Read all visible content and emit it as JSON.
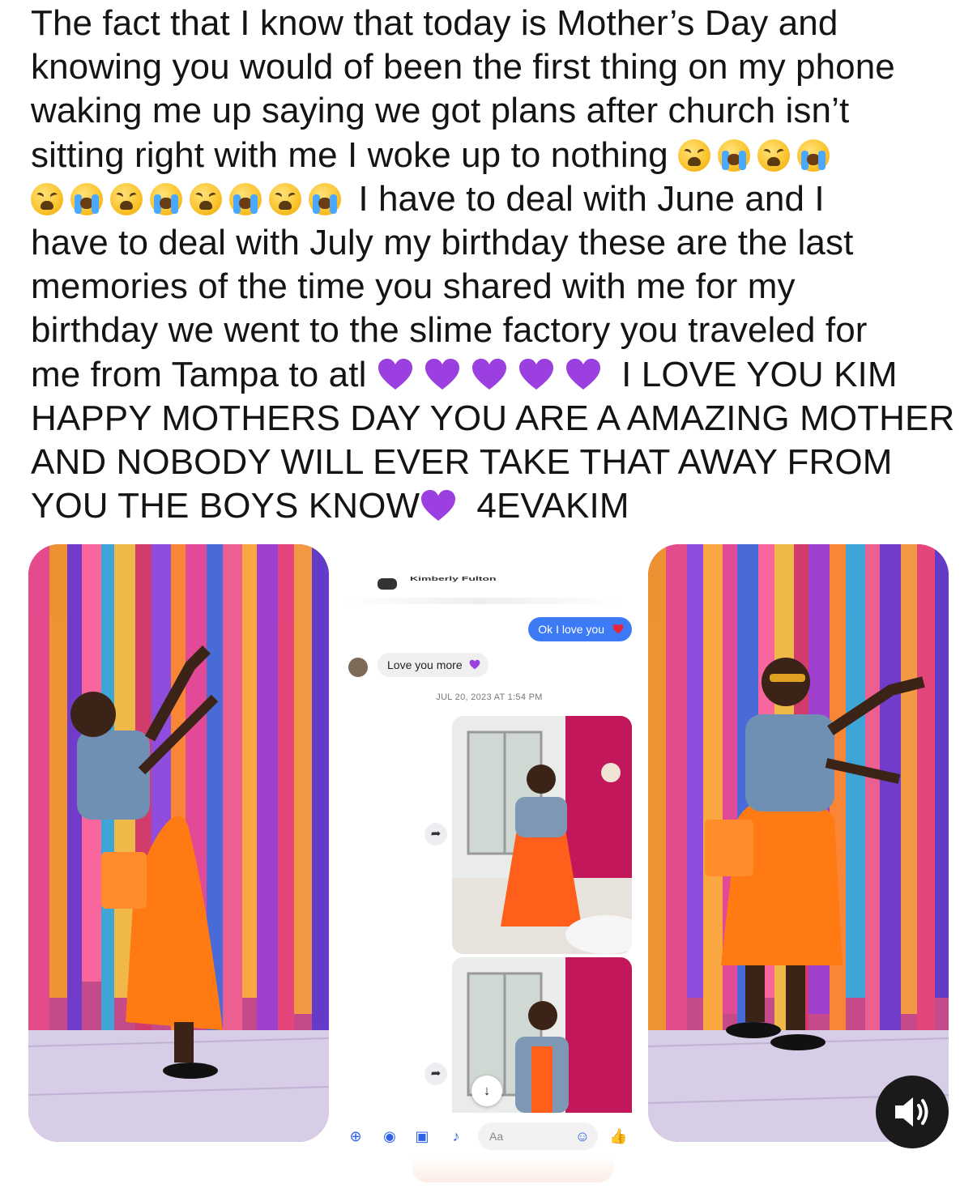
{
  "post": {
    "lines": [
      "The fact that I know that today is Mother’s Day and",
      "knowing you would of been the first thing on my phone",
      "waking me up saying we got plans after church isn’t",
      "sitting right with me I woke up to nothing",
      "I have to deal with June and I",
      "have to deal with July my birthday these are the last",
      "memories of the time you shared with me for my",
      "birthday we went to the slime factory you traveled for",
      "me from Tampa to atl",
      "I LOVE YOU KIM",
      "HAPPY MOTHERS DAY YOU ARE A AMAZING MOTHER",
      "AND NOBODY WILL EVER TAKE THAT AWAY FROM",
      "YOU THE BOYS KNOW",
      "4EVAKIM"
    ],
    "emoji": {
      "tired": "weary-face",
      "cry": "loudly-crying-face",
      "heart": "purple-heart"
    }
  },
  "screenshot": {
    "contact_name": "Kimberly Fulton",
    "outgoing_message": "Ok I love you",
    "incoming_message": "Love you more",
    "timestamp": "JUL 20, 2023 AT 1:54 PM",
    "composer_placeholder": "Aa",
    "bubble_color": "#3d7bf6"
  },
  "media": {
    "sound_button": "speaker-icon"
  },
  "colors": {
    "text": "#141414",
    "purple_heart": "#9b3fe0",
    "dress": "#ff7a12"
  }
}
